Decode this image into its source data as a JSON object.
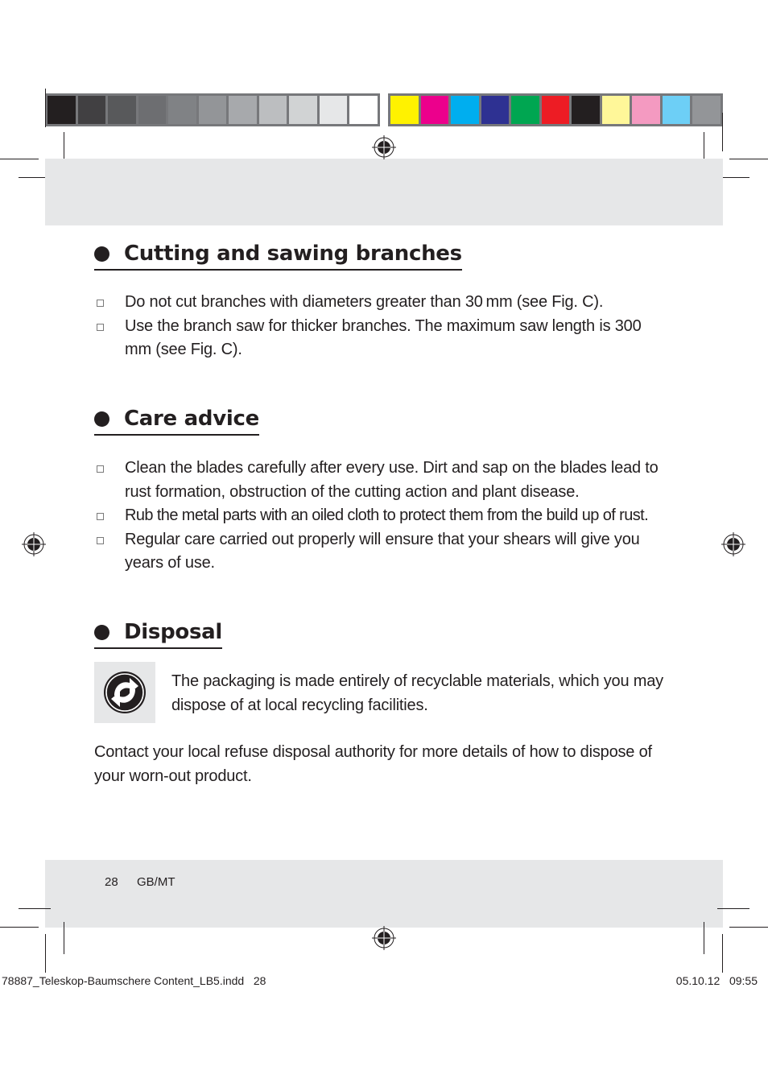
{
  "color_bars": {
    "grayscale": [
      "#231f20",
      "#414042",
      "#58595b",
      "#6d6e71",
      "#808285",
      "#939598",
      "#a7a9ac",
      "#bcbec0",
      "#d1d3d4",
      "#e6e7e8",
      "#ffffff"
    ],
    "process": [
      "#fff200",
      "#ec008c",
      "#00aeef",
      "#2e3192",
      "#00a651",
      "#ed1c24",
      "#231f20",
      "#fff799",
      "#f49ac1",
      "#6dcff6",
      "#939598"
    ]
  },
  "sections": [
    {
      "title": "Cutting and sawing branches",
      "items": [
        "Do not cut branches with diameters greater than 30 mm (see Fig. C).",
        "Use the branch saw for thicker branches. The maximum saw length is 300 mm (see Fig. C)."
      ]
    },
    {
      "title": "Care advice",
      "items": [
        "Clean the blades carefully after every use. Dirt and sap on the blades lead to rust formation, obstruction of the cutting action and plant disease.",
        "Rub the metal parts with an oiled cloth to protect them from the build up of rust.",
        "Regular care carried out properly will ensure that your shears will give you years of use."
      ]
    },
    {
      "title": "Disposal",
      "recycle_icon": "green-dot-recycling-icon",
      "packaging_text": "The packaging is made entirely of recyclable materials, which you may dispose of at local recycling facilities.",
      "contact_text": "Contact your local refuse disposal authority for more details of how to dispose of your worn-out product."
    }
  ],
  "footer": {
    "page_number": "28",
    "locale": "GB/MT"
  },
  "slug": {
    "filename": "78887_Teleskop-Baumschere Content_LB5.indd   28",
    "datetime": "05.10.12   09:55"
  }
}
